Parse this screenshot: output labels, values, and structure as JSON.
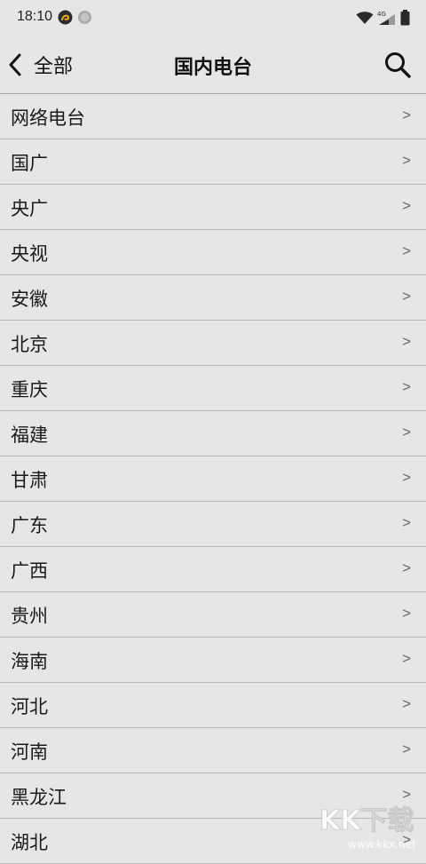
{
  "status_bar": {
    "time": "18:10",
    "network_label": "4G",
    "icons": [
      "app-notification-icon",
      "dot-icon",
      "wifi-icon",
      "cellular-icon",
      "battery-icon"
    ]
  },
  "header": {
    "back_label": "全部",
    "title": "国内电台",
    "back_icon": "chevron-left-icon",
    "search_icon": "search-icon"
  },
  "list": {
    "arrow": ">",
    "items": [
      {
        "label": "网络电台"
      },
      {
        "label": "国广"
      },
      {
        "label": "央广"
      },
      {
        "label": "央视"
      },
      {
        "label": "安徽"
      },
      {
        "label": "北京"
      },
      {
        "label": "重庆"
      },
      {
        "label": "福建"
      },
      {
        "label": "甘肃"
      },
      {
        "label": "广东"
      },
      {
        "label": "广西"
      },
      {
        "label": "贵州"
      },
      {
        "label": "海南"
      },
      {
        "label": "河北"
      },
      {
        "label": "河南"
      },
      {
        "label": "黑龙江"
      },
      {
        "label": "湖北"
      }
    ]
  },
  "watermark": {
    "logo_text": "KK下载",
    "url": "www.kkx.net"
  },
  "colors": {
    "background": "#e6e6e6",
    "divider": "#b8b8b8",
    "text": "#1a1a1a",
    "arrow": "#666666",
    "app_icon_bg": "#e8a31d"
  }
}
